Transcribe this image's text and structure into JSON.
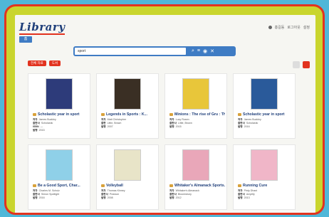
{
  "header": {
    "logo": "Library",
    "home": "홈",
    "user": "홍길동",
    "links": [
      "로그아웃",
      "설정"
    ]
  },
  "search": {
    "value": "sport"
  },
  "filters": [
    "전체 자료",
    "도서"
  ],
  "books": [
    {
      "title": "Scholastic year in sport",
      "meta": [
        [
          "저자",
          "James Buckley"
        ],
        [
          "출판사",
          "Scholastic"
        ],
        [
          "ISBN",
          "—"
        ],
        [
          "발행",
          "2015"
        ]
      ],
      "cover": "#2d3b7a"
    },
    {
      "title": "Legends in Sports : K...",
      "meta": [
        [
          "저자",
          "Matt Christopher"
        ],
        [
          "출판",
          "Little, Brown"
        ],
        [
          "발행",
          "2007"
        ]
      ],
      "cover": "#3a2f24"
    },
    {
      "title": "Minions : The rise of Gru : Th...",
      "meta": [
        [
          "저자",
          "Lucy Rosen"
        ],
        [
          "출판사",
          "Little, Brown"
        ],
        [
          "발행",
          "2015"
        ]
      ],
      "cover": "#e8c63a"
    },
    {
      "title": "Scholastic year in sport",
      "meta": [
        [
          "저자",
          "James Buckley"
        ],
        [
          "출판사",
          "Scholastic"
        ],
        [
          "발행",
          "2016"
        ]
      ],
      "cover": "#2a5a9a"
    },
    {
      "title": "Be a Good Sport, Char...",
      "meta": [
        [
          "저자",
          "Charles M. Schulz"
        ],
        [
          "출판사",
          "Simon Spotlight"
        ],
        [
          "발행",
          "2016"
        ]
      ],
      "cover": "#8fd0e8"
    },
    {
      "title": "Volleyball",
      "meta": [
        [
          "저자",
          "Thomas Kinney"
        ],
        [
          "출판사",
          "Pearson"
        ],
        [
          "발행",
          "2008"
        ]
      ],
      "cover": "#e8e4c8"
    },
    {
      "title": "Whitaker's Almanack Sports...",
      "meta": [
        [
          "저자",
          "Whitaker's Almanack"
        ],
        [
          "출판사",
          "Bloomsbury"
        ],
        [
          "발행",
          "2012"
        ]
      ],
      "cover": "#e9a7b9"
    },
    {
      "title": "Running Cure",
      "meta": [
        [
          "저자",
          "Pirdy Dhani"
        ],
        [
          "출판사",
          "Amplify"
        ],
        [
          "발행",
          "2013"
        ]
      ],
      "cover": "#f0b6c8"
    }
  ]
}
